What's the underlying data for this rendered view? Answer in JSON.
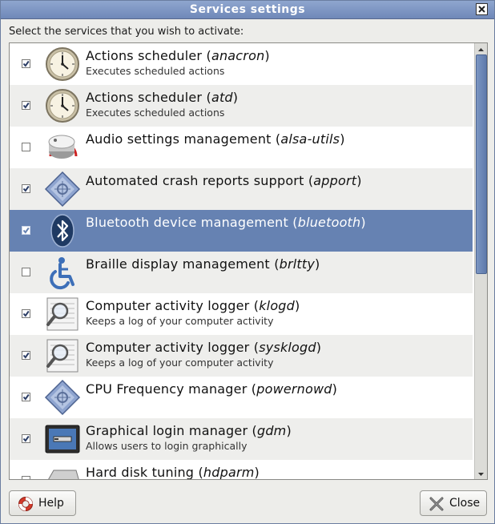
{
  "window": {
    "title": "Services settings"
  },
  "instruction": "Select the services that you wish to activate:",
  "services": [
    {
      "name": "Actions scheduler",
      "pkg": "anacron",
      "desc": "Executes scheduled actions",
      "checked": true,
      "selected": false,
      "icon": "clock-icon"
    },
    {
      "name": "Actions scheduler",
      "pkg": "atd",
      "desc": "Executes scheduled actions",
      "checked": true,
      "selected": false,
      "icon": "clock-icon"
    },
    {
      "name": "Audio settings management",
      "pkg": "alsa-utils",
      "desc": "",
      "checked": false,
      "selected": false,
      "icon": "volume-knob-icon"
    },
    {
      "name": "Automated crash reports support",
      "pkg": "apport",
      "desc": "",
      "checked": true,
      "selected": false,
      "icon": "system-diamond-icon"
    },
    {
      "name": "Bluetooth device management",
      "pkg": "bluetooth",
      "desc": "",
      "checked": true,
      "selected": true,
      "icon": "bluetooth-icon"
    },
    {
      "name": "Braille display management",
      "pkg": "brltty",
      "desc": "",
      "checked": false,
      "selected": false,
      "icon": "accessibility-icon"
    },
    {
      "name": "Computer activity logger",
      "pkg": "klogd",
      "desc": "Keeps a log of your computer activity",
      "checked": true,
      "selected": false,
      "icon": "log-viewer-icon"
    },
    {
      "name": "Computer activity logger",
      "pkg": "sysklogd",
      "desc": "Keeps a log of your computer activity",
      "checked": true,
      "selected": false,
      "icon": "log-viewer-icon"
    },
    {
      "name": "CPU Frequency manager",
      "pkg": "powernowd",
      "desc": "",
      "checked": true,
      "selected": false,
      "icon": "system-diamond-icon"
    },
    {
      "name": "Graphical login manager",
      "pkg": "gdm",
      "desc": "Allows users to login graphically",
      "checked": true,
      "selected": false,
      "icon": "login-screen-icon"
    },
    {
      "name": "Hard disk tuning",
      "pkg": "hdparm",
      "desc": "",
      "checked": false,
      "selected": false,
      "icon": "hard-disk-icon"
    }
  ],
  "buttons": {
    "help": "Help",
    "close": "Close"
  },
  "colors": {
    "selection": "#6682b2",
    "titlebar": "#7f97c4",
    "scroll_thumb": "#6f89b8"
  }
}
